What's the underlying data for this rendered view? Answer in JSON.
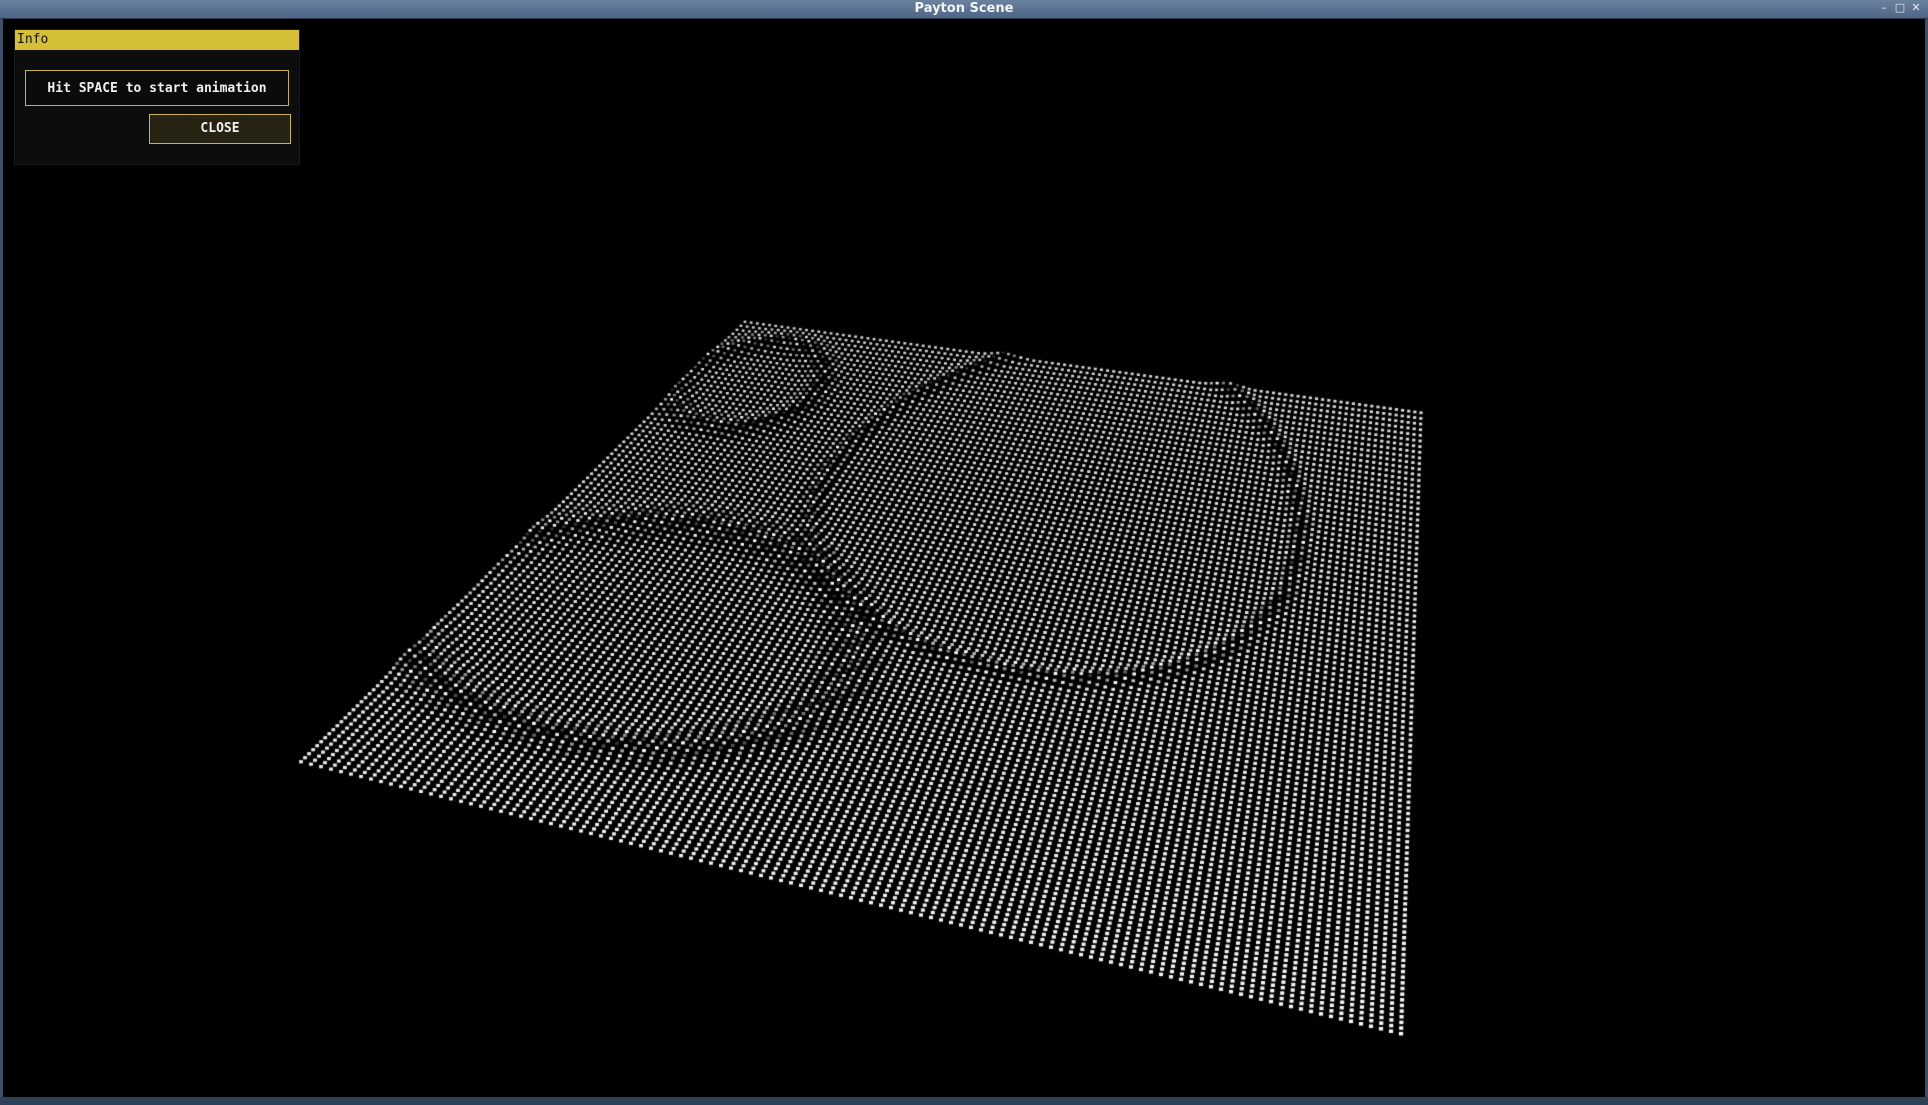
{
  "window": {
    "title": "Payton Scene",
    "controls": {
      "minimize": "–",
      "maximize": "□",
      "close": "✕"
    }
  },
  "info_panel": {
    "header": "Info",
    "message": "Hit SPACE to start animation",
    "close_label": "CLOSE"
  },
  "colors": {
    "header_bg": "#d4bf36",
    "border": "#c8b24a",
    "background": "#000000",
    "points": "#ffffff"
  }
}
